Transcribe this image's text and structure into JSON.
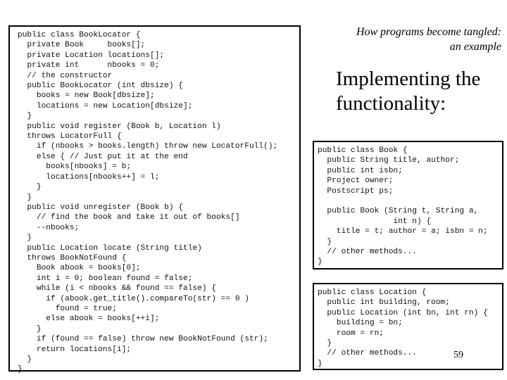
{
  "slide": {
    "subtitle_line1": "How programs become tangled:",
    "subtitle_line2": "an example",
    "heading_line1": "Implementing the",
    "heading_line2": "functionality:",
    "page_number": "59"
  },
  "code_blocks": {
    "book_locator": "public class BookLocator {\n  private Book     books[];\n  private Location locations[];\n  private int      nbooks = 0;\n  // the constructor\n  public BookLocator (int dbsize) {\n    books = new Book[dbsize];\n    locations = new Location[dbsize];\n  }\n  public void register (Book b, Location l)\n  throws LocatorFull {\n    if (nbooks > books.length) throw new LocatorFull();\n    else { // Just put it at the end\n      books[nbooks] = b;\n      locations[nbooks++] = l;\n    }\n  }\n  public void unregister (Book b) {\n    // find the book and take it out of books[]\n    --nbooks;\n  }\n  public Location locate (String title)\n  throws BookNotFound {\n    Book abook = books[0];\n    int i = 0; boolean found = false;\n    while (i < nbooks && found == false) {\n      if (abook.get_title().compareTo(str) == 0 )\n        found = true;\n      else abook = books[++i];\n    }\n    if (found == false) throw new BookNotFound (str);\n    return locations[i];\n  }\n}",
    "book": "public class Book {\n  public String title, author;\n  public int isbn;\n  Project owner;\n  Postscript ps;\n\n  public Book (String t, String a,\n                int n) {\n    title = t; author = a; isbn = n;\n  }\n  // other methods...\n}",
    "location": "public class Location {\n  public int building, room;\n  public Location (int bn, int rn) {\n    building = bn;\n    room = rn;\n  }\n  // other methods...\n}"
  }
}
